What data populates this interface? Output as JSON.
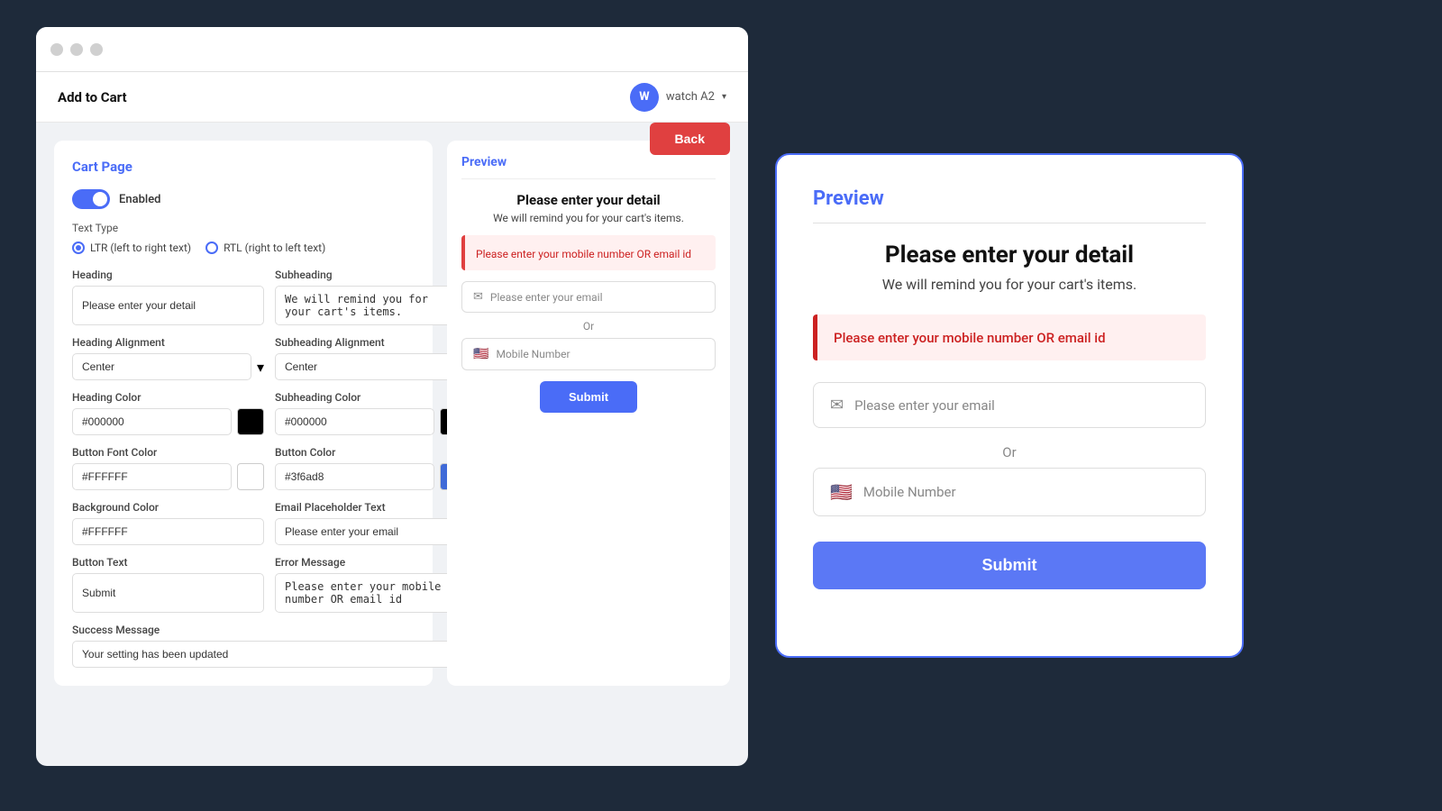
{
  "window": {
    "dots": [
      "dot1",
      "dot2",
      "dot3"
    ],
    "header_title": "Add to Cart",
    "watch_avatar": "W",
    "watch_label": "watch A2",
    "back_button": "Back"
  },
  "cart_panel": {
    "title": "Cart Page",
    "toggle_label": "Enabled",
    "text_type_label": "Text Type",
    "ltr_label": "LTR (left to right text)",
    "rtl_label": "RTL (right to left text)",
    "heading_label": "Heading",
    "heading_value": "Please enter your detail",
    "subheading_label": "Subheading",
    "subheading_value": "We will remind you for your cart's items.",
    "heading_align_label": "Heading Alignment",
    "heading_align_value": "Center",
    "subheading_align_label": "Subheading Alignment",
    "subheading_align_value": "Center",
    "heading_color_label": "Heading Color",
    "heading_color_value": "#000000",
    "heading_color_swatch": "#000000",
    "subheading_color_label": "Subheading Color",
    "subheading_color_value": "#000000",
    "subheading_color_swatch": "#000000",
    "button_font_color_label": "Button Font Color",
    "button_font_color_value": "#FFFFFF",
    "button_font_color_swatch": "#FFFFFF",
    "button_color_label": "Button Color",
    "button_color_value": "#3f6ad8",
    "button_color_swatch": "#3f6ad8",
    "background_color_label": "Background Color",
    "background_color_value": "#FFFFFF",
    "email_placeholder_label": "Email Placeholder Text",
    "email_placeholder_value": "Please enter your email",
    "button_text_label": "Button Text",
    "button_text_value": "Submit",
    "error_message_label": "Error Message",
    "error_message_value": "Please enter your mobile number OR email id",
    "success_message_label": "Success Message",
    "success_message_value": "Your setting has been updated"
  },
  "small_preview": {
    "title": "Preview",
    "heading": "Please enter your detail",
    "subheading": "We will remind you for your cart's items.",
    "error_text": "Please enter your mobile number OR email id",
    "email_placeholder": "Please enter your email",
    "or_text": "Or",
    "mobile_placeholder": "Mobile Number",
    "submit_label": "Submit"
  },
  "large_preview": {
    "title": "Preview",
    "heading": "Please enter your detail",
    "subheading": "We will remind you for your cart's items.",
    "error_text": "Please enter your mobile number OR email id",
    "email_placeholder": "Please enter your email",
    "or_text": "Or",
    "mobile_placeholder": "Mobile Number",
    "submit_label": "Submit"
  }
}
